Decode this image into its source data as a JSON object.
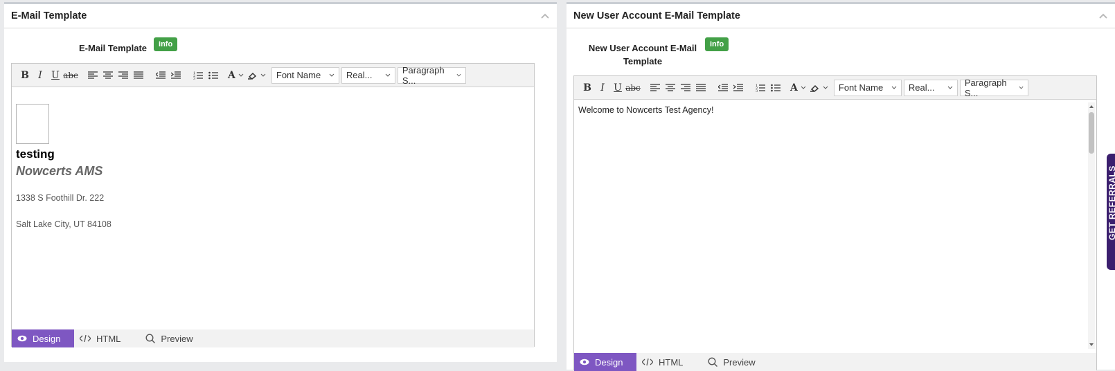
{
  "left_panel": {
    "title": "E-Mail Template",
    "field_label": "E-Mail Template",
    "info": "info",
    "toolbar": {
      "font_name": "Font Name",
      "font_size": "Real...",
      "paragraph": "Paragraph S..."
    },
    "content": {
      "heading": "testing",
      "company": "Nowcerts AMS",
      "address1": "1338 S Foothill Dr. 222",
      "address2": "Salt Lake City, UT 84108"
    },
    "modes": {
      "design": "Design",
      "html": "HTML",
      "preview": "Preview"
    }
  },
  "right_panel": {
    "title": "New User Account E-Mail Template",
    "field_label_line1": "New User Account E-Mail",
    "field_label_line2": "Template",
    "info": "info",
    "toolbar": {
      "font_name": "Font Name",
      "font_size": "Real...",
      "paragraph": "Paragraph S..."
    },
    "content": {
      "text": "Welcome to Nowcerts Test Agency!"
    },
    "modes": {
      "design": "Design",
      "html": "HTML",
      "preview": "Preview"
    }
  },
  "side_tab": {
    "label": "GET REFERRALS"
  },
  "colors": {
    "accent": "#7e57c2",
    "info_green": "#43a047",
    "side_tab": "#3b1f6e"
  }
}
